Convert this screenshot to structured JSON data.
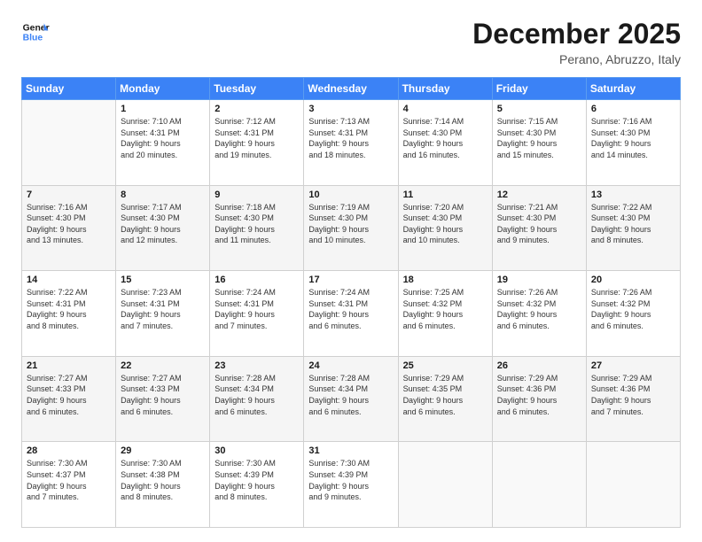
{
  "logo": {
    "line1": "General",
    "line2": "Blue"
  },
  "title": "December 2025",
  "location": "Perano, Abruzzo, Italy",
  "days_of_week": [
    "Sunday",
    "Monday",
    "Tuesday",
    "Wednesday",
    "Thursday",
    "Friday",
    "Saturday"
  ],
  "weeks": [
    [
      {
        "num": "",
        "info": ""
      },
      {
        "num": "1",
        "info": "Sunrise: 7:10 AM\nSunset: 4:31 PM\nDaylight: 9 hours\nand 20 minutes."
      },
      {
        "num": "2",
        "info": "Sunrise: 7:12 AM\nSunset: 4:31 PM\nDaylight: 9 hours\nand 19 minutes."
      },
      {
        "num": "3",
        "info": "Sunrise: 7:13 AM\nSunset: 4:31 PM\nDaylight: 9 hours\nand 18 minutes."
      },
      {
        "num": "4",
        "info": "Sunrise: 7:14 AM\nSunset: 4:30 PM\nDaylight: 9 hours\nand 16 minutes."
      },
      {
        "num": "5",
        "info": "Sunrise: 7:15 AM\nSunset: 4:30 PM\nDaylight: 9 hours\nand 15 minutes."
      },
      {
        "num": "6",
        "info": "Sunrise: 7:16 AM\nSunset: 4:30 PM\nDaylight: 9 hours\nand 14 minutes."
      }
    ],
    [
      {
        "num": "7",
        "info": "Sunrise: 7:16 AM\nSunset: 4:30 PM\nDaylight: 9 hours\nand 13 minutes."
      },
      {
        "num": "8",
        "info": "Sunrise: 7:17 AM\nSunset: 4:30 PM\nDaylight: 9 hours\nand 12 minutes."
      },
      {
        "num": "9",
        "info": "Sunrise: 7:18 AM\nSunset: 4:30 PM\nDaylight: 9 hours\nand 11 minutes."
      },
      {
        "num": "10",
        "info": "Sunrise: 7:19 AM\nSunset: 4:30 PM\nDaylight: 9 hours\nand 10 minutes."
      },
      {
        "num": "11",
        "info": "Sunrise: 7:20 AM\nSunset: 4:30 PM\nDaylight: 9 hours\nand 10 minutes."
      },
      {
        "num": "12",
        "info": "Sunrise: 7:21 AM\nSunset: 4:30 PM\nDaylight: 9 hours\nand 9 minutes."
      },
      {
        "num": "13",
        "info": "Sunrise: 7:22 AM\nSunset: 4:30 PM\nDaylight: 9 hours\nand 8 minutes."
      }
    ],
    [
      {
        "num": "14",
        "info": "Sunrise: 7:22 AM\nSunset: 4:31 PM\nDaylight: 9 hours\nand 8 minutes."
      },
      {
        "num": "15",
        "info": "Sunrise: 7:23 AM\nSunset: 4:31 PM\nDaylight: 9 hours\nand 7 minutes."
      },
      {
        "num": "16",
        "info": "Sunrise: 7:24 AM\nSunset: 4:31 PM\nDaylight: 9 hours\nand 7 minutes."
      },
      {
        "num": "17",
        "info": "Sunrise: 7:24 AM\nSunset: 4:31 PM\nDaylight: 9 hours\nand 6 minutes."
      },
      {
        "num": "18",
        "info": "Sunrise: 7:25 AM\nSunset: 4:32 PM\nDaylight: 9 hours\nand 6 minutes."
      },
      {
        "num": "19",
        "info": "Sunrise: 7:26 AM\nSunset: 4:32 PM\nDaylight: 9 hours\nand 6 minutes."
      },
      {
        "num": "20",
        "info": "Sunrise: 7:26 AM\nSunset: 4:32 PM\nDaylight: 9 hours\nand 6 minutes."
      }
    ],
    [
      {
        "num": "21",
        "info": "Sunrise: 7:27 AM\nSunset: 4:33 PM\nDaylight: 9 hours\nand 6 minutes."
      },
      {
        "num": "22",
        "info": "Sunrise: 7:27 AM\nSunset: 4:33 PM\nDaylight: 9 hours\nand 6 minutes."
      },
      {
        "num": "23",
        "info": "Sunrise: 7:28 AM\nSunset: 4:34 PM\nDaylight: 9 hours\nand 6 minutes."
      },
      {
        "num": "24",
        "info": "Sunrise: 7:28 AM\nSunset: 4:34 PM\nDaylight: 9 hours\nand 6 minutes."
      },
      {
        "num": "25",
        "info": "Sunrise: 7:29 AM\nSunset: 4:35 PM\nDaylight: 9 hours\nand 6 minutes."
      },
      {
        "num": "26",
        "info": "Sunrise: 7:29 AM\nSunset: 4:36 PM\nDaylight: 9 hours\nand 6 minutes."
      },
      {
        "num": "27",
        "info": "Sunrise: 7:29 AM\nSunset: 4:36 PM\nDaylight: 9 hours\nand 7 minutes."
      }
    ],
    [
      {
        "num": "28",
        "info": "Sunrise: 7:30 AM\nSunset: 4:37 PM\nDaylight: 9 hours\nand 7 minutes."
      },
      {
        "num": "29",
        "info": "Sunrise: 7:30 AM\nSunset: 4:38 PM\nDaylight: 9 hours\nand 8 minutes."
      },
      {
        "num": "30",
        "info": "Sunrise: 7:30 AM\nSunset: 4:39 PM\nDaylight: 9 hours\nand 8 minutes."
      },
      {
        "num": "31",
        "info": "Sunrise: 7:30 AM\nSunset: 4:39 PM\nDaylight: 9 hours\nand 9 minutes."
      },
      {
        "num": "",
        "info": ""
      },
      {
        "num": "",
        "info": ""
      },
      {
        "num": "",
        "info": ""
      }
    ]
  ]
}
